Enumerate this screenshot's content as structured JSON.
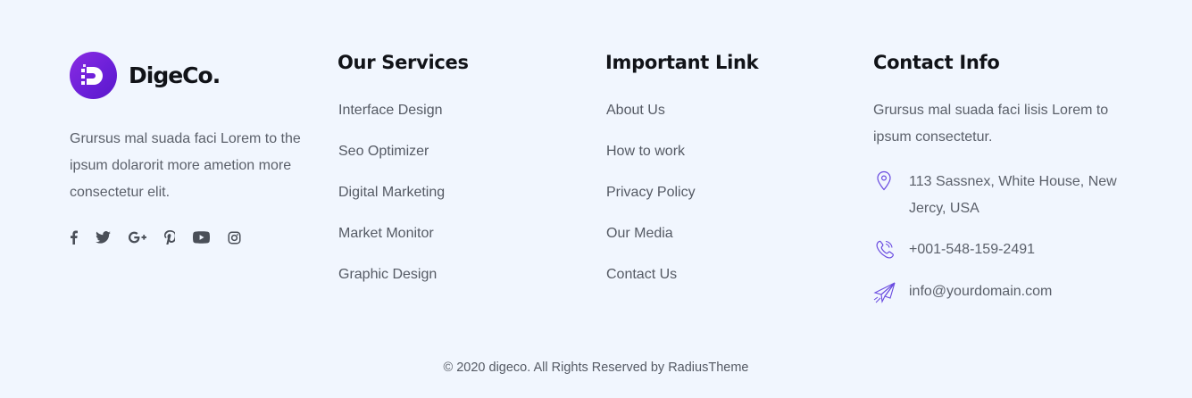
{
  "brand": {
    "name": "DigeCo.",
    "description": "Grursus mal suada faci Lorem to the ipsum dolarorit more ametion more consectetur elit.",
    "accent_color": "#7b2ae0"
  },
  "social": [
    {
      "icon": "facebook-icon"
    },
    {
      "icon": "twitter-icon"
    },
    {
      "icon": "google-plus-icon"
    },
    {
      "icon": "pinterest-icon"
    },
    {
      "icon": "youtube-icon"
    },
    {
      "icon": "instagram-icon"
    }
  ],
  "services": {
    "title": "Our Services",
    "items": [
      "Interface Design",
      "Seo Optimizer",
      "Digital Marketing",
      "Market Monitor",
      "Graphic Design"
    ]
  },
  "important_links": {
    "title": "Important Link",
    "items": [
      "About Us",
      "How to work",
      "Privacy Policy",
      "Our Media",
      "Contact Us"
    ]
  },
  "contact": {
    "title": "Contact Info",
    "description": "Grursus mal suada faci lisis Lorem to ipsum consectetur.",
    "address": "113 Sassnex, White House, New Jercy, USA",
    "phone": "+001-548-159-2491",
    "email": "info@yourdomain.com",
    "icon_color": "#6a4be0"
  },
  "copyright": "© 2020 digeco. All Rights Reserved by RadiusTheme"
}
